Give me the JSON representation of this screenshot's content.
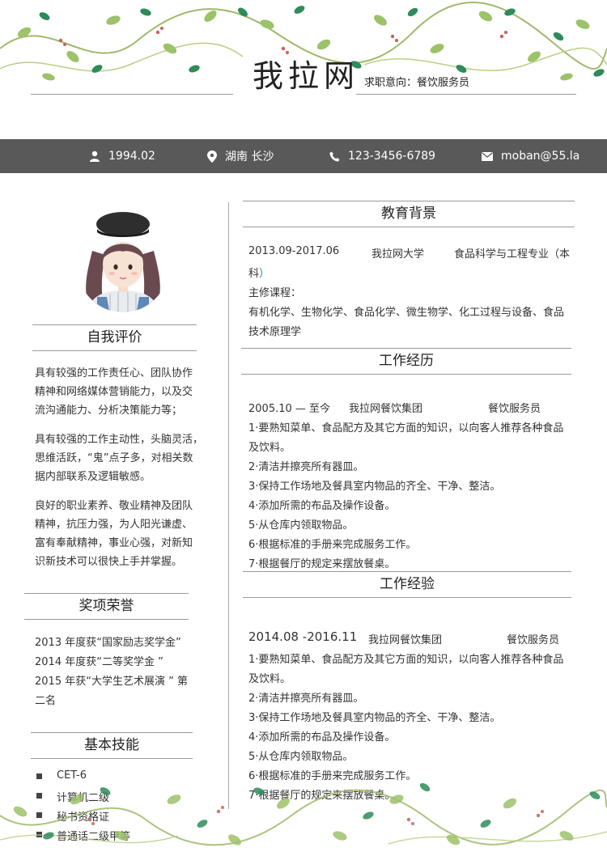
{
  "header": {
    "name": "我拉网",
    "intent": "求职意向：餐饮服务员"
  },
  "info": {
    "birth": "1994.02",
    "location": "湖南 长沙",
    "phone": "123-3456-6789",
    "email": "moban@55.la",
    "icons": [
      "user-icon",
      "location-pin-icon",
      "phone-icon",
      "mail-icon"
    ]
  },
  "left": {
    "self_eval": {
      "title": "自我评价",
      "paragraphs": [
        [
          "具有较强的工作责任心、团队协作",
          "精神和网络媒体营销能力，以及交",
          "流沟通能力、分析决策能力等；"
        ],
        [
          "具有较强的工作主动性，头脑灵活，",
          "思维活跃，“鬼”点子多，对相关数",
          "据内部联系及逻辑敏感。"
        ],
        [
          "良好的职业素养、敬业精神及团队",
          "精神，抗压力强，为人阳光谦虚、",
          "富有奉献精神，事业心强，对新知",
          "识新技术可以很快上手并掌握。"
        ]
      ]
    },
    "awards": {
      "title": "奖项荣誉",
      "lines": [
        "2013 年度获“国家励志奖学金”",
        "2014 年度获“二等奖学金 ”",
        "2015 年获“大学生艺术展演 ” 第",
        "二名"
      ]
    },
    "skills": {
      "title": "基本技能",
      "items": [
        "CET-6",
        "计算机二级",
        "秘书资格证",
        "普通话二级甲等"
      ]
    }
  },
  "right": {
    "education": {
      "title": "教育背景",
      "date": "2013.09-2017.06",
      "school": "我拉网大学",
      "major": "食品科学与工程专业（本",
      "major_cont": "科",
      "major_paren": "）",
      "courses_label": "主修课程：",
      "courses": [
        "有机化学、生物化学、食品化学、微生物学、化工过程与设备、食品",
        "技术原理学"
      ]
    },
    "work_history": {
      "title": "工作经历",
      "date": "2005.10 — 至今",
      "company": "我拉网餐饮集团",
      "role": "餐饮服务员",
      "items": [
        "1·要熟知菜单、食品配方及其它方面的知识，以向客人推荐各种食品",
        "及饮料。",
        "2·清洁并擦亮所有器皿。",
        "3·保持工作场地及餐具室内物品的齐全、干净、整洁。",
        "4·添加所需的布品及操作设备。",
        "5·从仓库内领取物品。",
        "6·根据标准的手册来完成服务工作。",
        "7·根据餐厅的规定来摆放餐桌。"
      ]
    },
    "work_exp": {
      "title": "工作经验",
      "date": "2014.08 -2016.11",
      "company": "我拉网餐饮集团",
      "role": "餐饮服务员",
      "items": [
        "1·要熟知菜单、食品配方及其它方面的知识，以向客人推荐各种食品",
        "及饮料。",
        "2·清洁并擦亮所有器皿。",
        "3·保持工作场地及餐具室内物品的齐全、干净、整洁。",
        "4·添加所需的布品及操作设备。",
        "5·从仓库内领取物品。",
        "6·根据标准的手册来完成服务工作。",
        "7·根据餐厅的规定来摆放餐桌。"
      ]
    }
  },
  "colors": {
    "bar": "#595959",
    "leaf_dark": "#2e8b5a",
    "leaf_light": "#9cc26a",
    "vine": "#9fb96b",
    "berry": "#c7605a",
    "accent_blue": "#2a7bd6"
  }
}
